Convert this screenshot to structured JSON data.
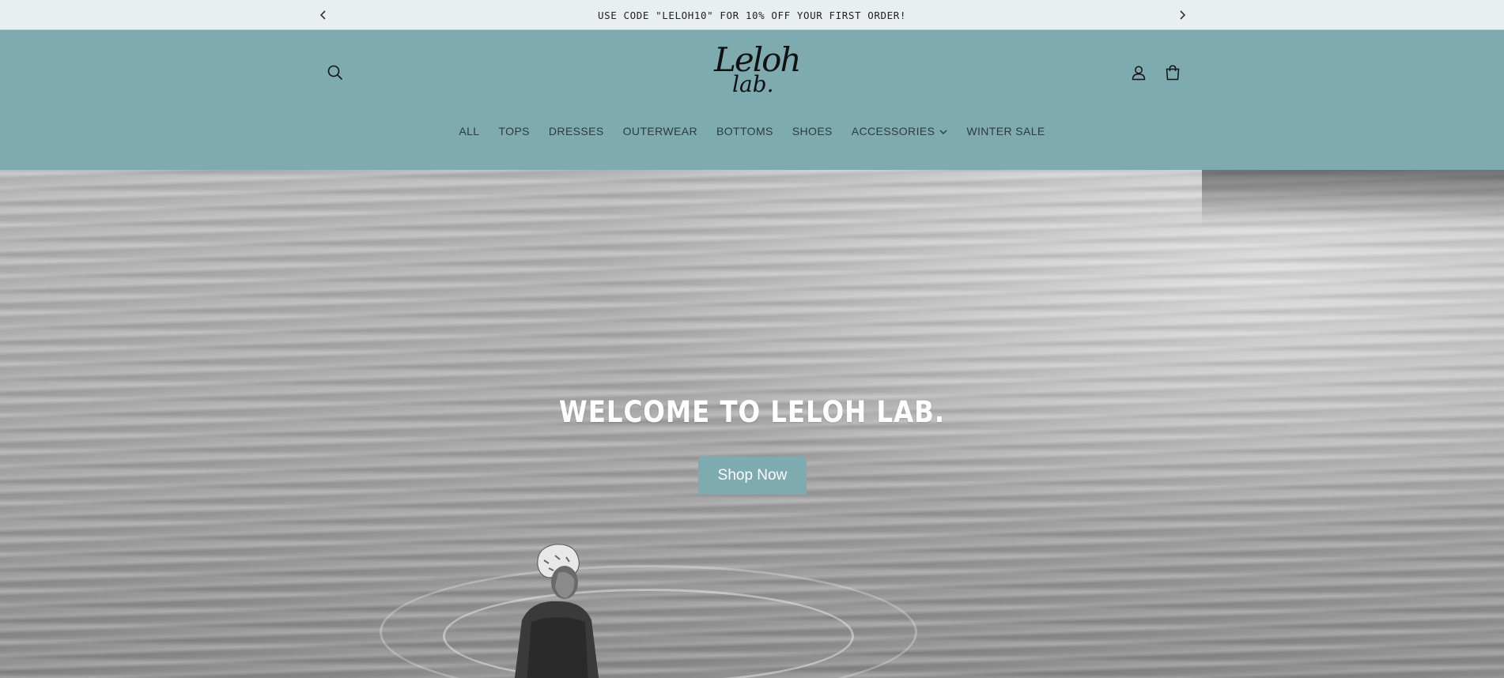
{
  "announcement": {
    "text": "USE CODE \"LELOH10\" FOR 10% OFF YOUR FIRST ORDER!",
    "prev_icon": "chevron-left-icon",
    "next_icon": "chevron-right-icon"
  },
  "header": {
    "logo_line1": "Leloh",
    "logo_line2": "lab.",
    "icons": [
      "search-icon",
      "account-icon",
      "cart-icon"
    ],
    "nav": [
      {
        "label": "ALL"
      },
      {
        "label": "TOPS"
      },
      {
        "label": "DRESSES"
      },
      {
        "label": "OUTERWEAR"
      },
      {
        "label": "BOTTOMS"
      },
      {
        "label": "SHOES"
      },
      {
        "label": "ACCESSORIES",
        "has_dropdown": true
      },
      {
        "label": "WINTER SALE"
      }
    ]
  },
  "hero": {
    "title": "WELCOME TO LELOH LAB.",
    "cta_label": "Shop Now"
  },
  "colors": {
    "header_bg": "#7eabaf",
    "announcement_bg": "#e9efef",
    "button_bg": "#7eabaf"
  }
}
